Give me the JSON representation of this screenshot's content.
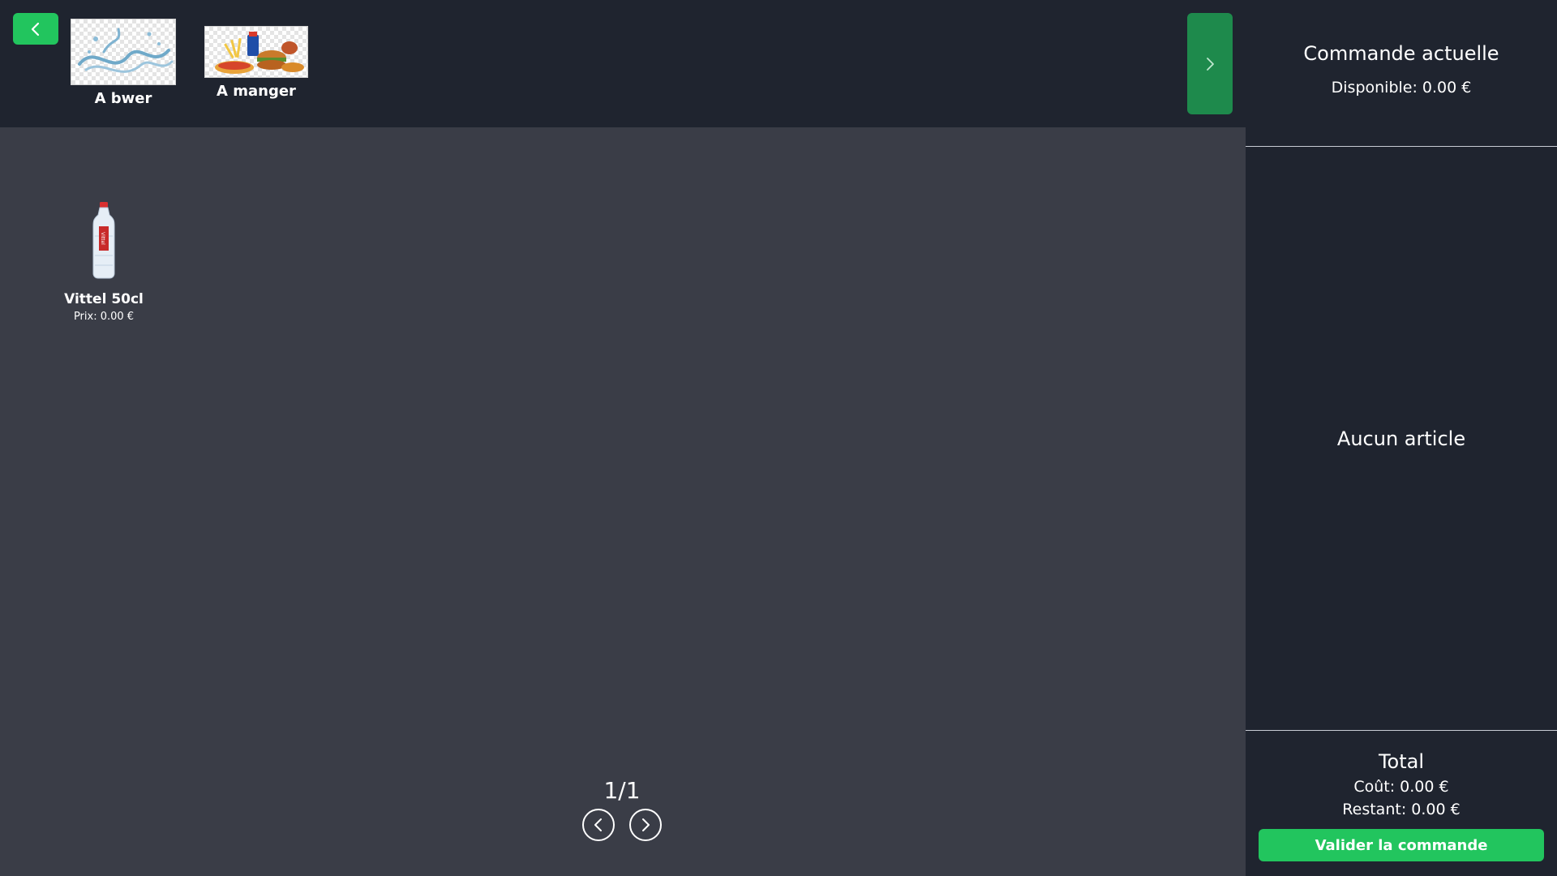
{
  "categories": [
    {
      "label": "A bwer",
      "icon": "water-splash-image"
    },
    {
      "label": "A manger",
      "icon": "fast-food-image"
    }
  ],
  "products": [
    {
      "name": "Vittel 50cl",
      "price": "Prix: 0.00 €",
      "icon": "water-bottle-image"
    }
  ],
  "pagination": {
    "indicator": "1/1"
  },
  "order": {
    "title": "Commande actuelle",
    "available": "Disponible: 0.00 €",
    "empty": "Aucun article",
    "total_title": "Total",
    "cost": "Coût: 0.00 €",
    "remaining": "Restant: 0.00 €",
    "validate_label": "Valider la commande"
  },
  "colors": {
    "accent": "#22c55e",
    "accent_dark": "#1e8a4c",
    "bar_bg": "#1f242f",
    "content_bg": "#3a3d47"
  }
}
